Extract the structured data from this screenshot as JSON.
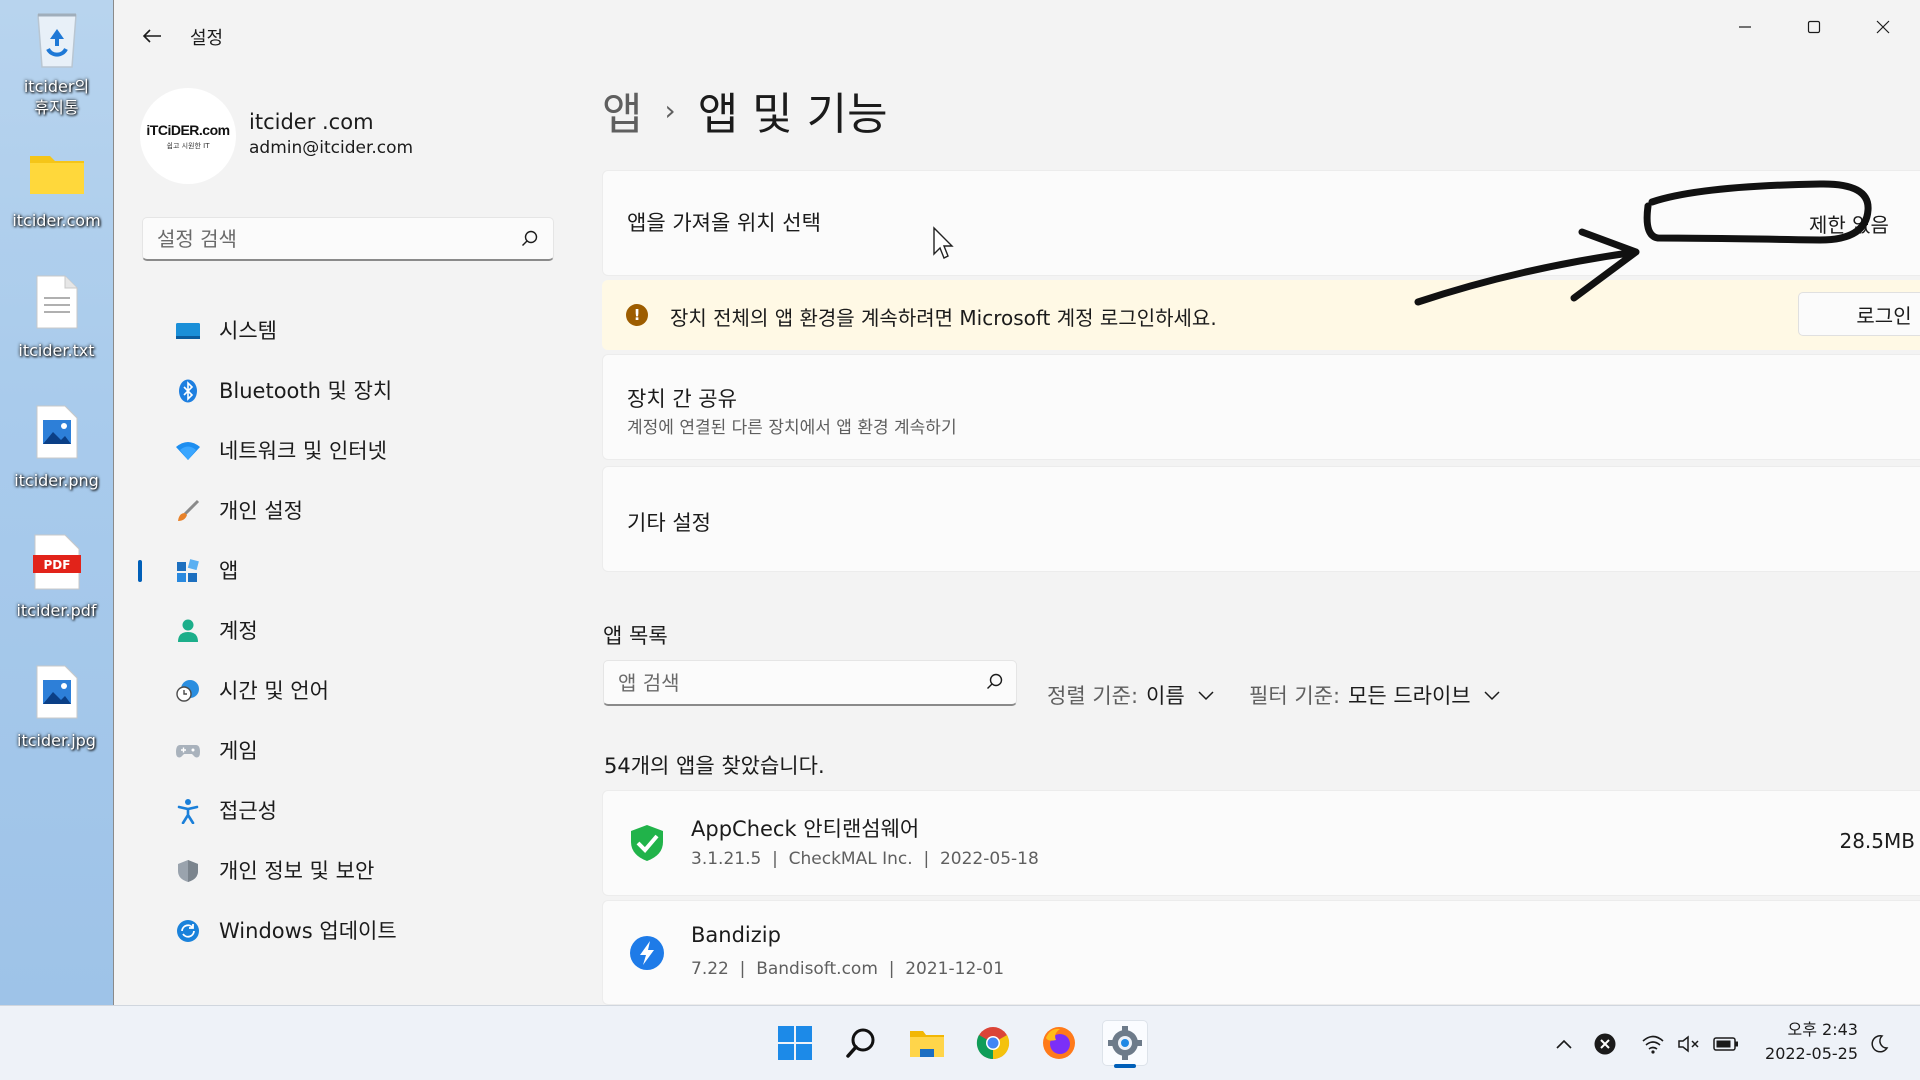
{
  "desktop": {
    "icons": [
      {
        "label": "itcider의\n휴지통",
        "icon": "recycle-bin-icon"
      },
      {
        "label": "itcider.com",
        "icon": "folder-icon"
      },
      {
        "label": "itcider.txt",
        "icon": "text-file-icon"
      },
      {
        "label": "itcider.png",
        "icon": "image-file-icon"
      },
      {
        "label": "itcider.pdf",
        "icon": "pdf-file-icon"
      },
      {
        "label": "itcider.jpg",
        "icon": "image-file-icon"
      }
    ]
  },
  "window": {
    "title": "설정"
  },
  "profile": {
    "logo_line1": "iTCiDER.com",
    "logo_line2": "쉽고 시원한 IT",
    "name": "itcider .com",
    "email": "admin@itcider.com"
  },
  "sidebar": {
    "search_placeholder": "설정 검색",
    "items": [
      {
        "label": "시스템",
        "icon": "system-icon"
      },
      {
        "label": "Bluetooth 및 장치",
        "icon": "bluetooth-icon"
      },
      {
        "label": "네트워크 및 인터넷",
        "icon": "wifi-icon"
      },
      {
        "label": "개인 설정",
        "icon": "brush-icon"
      },
      {
        "label": "앱",
        "icon": "apps-icon",
        "active": true
      },
      {
        "label": "계정",
        "icon": "account-icon"
      },
      {
        "label": "시간 및 언어",
        "icon": "time-language-icon"
      },
      {
        "label": "게임",
        "icon": "gamepad-icon"
      },
      {
        "label": "접근성",
        "icon": "accessibility-icon"
      },
      {
        "label": "개인 정보 및 보안",
        "icon": "shield-icon"
      },
      {
        "label": "Windows 업데이트",
        "icon": "update-icon"
      }
    ]
  },
  "main": {
    "breadcrumb_parent": "앱",
    "breadcrumb_separator": "›",
    "breadcrumb_current": "앱 및 기능",
    "source_card": {
      "title": "앱을 가져올 위치 선택",
      "dropdown_value": "제한 없음"
    },
    "banner": {
      "message": "장치 전체의 앱 환경을 계속하려면 Microsoft 계정 로그인하세요.",
      "button": "로그인",
      "icon_glyph": "!"
    },
    "share_card": {
      "title": "장치 간 공유",
      "subtitle": "계정에 연결된 다른 장치에서 앱 환경 계속하기"
    },
    "other_card": {
      "title": "기타 설정"
    },
    "app_list": {
      "heading": "앱 목록",
      "search_placeholder": "앱 검색",
      "sort_label": "정렬 기준:",
      "sort_value": "이름",
      "filter_label": "필터 기준:",
      "filter_value": "모든 드라이브",
      "count_text": "54개의 앱을 찾았습니다.",
      "apps": [
        {
          "name": "AppCheck 안티랜섬웨어",
          "meta": "3.1.21.5  |  CheckMAL Inc.  |  2022-05-18",
          "size": "28.5MB",
          "icon": "appcheck-icon"
        },
        {
          "name": "Bandizip",
          "meta": "7.22  |  Bandisoft.com  |  2021-12-01",
          "size": "",
          "icon": "bandizip-icon"
        }
      ]
    }
  },
  "taskbar": {
    "apps": [
      "start-icon",
      "search-icon",
      "file-explorer-icon",
      "chrome-icon",
      "firefox-icon",
      "settings-icon"
    ],
    "clock_time": "오후 2:43",
    "clock_date": "2022-05-25"
  },
  "colors": {
    "accent": "#005fb8",
    "warning_bg": "#fff9e5",
    "warning_icon": "#9d5d00"
  }
}
